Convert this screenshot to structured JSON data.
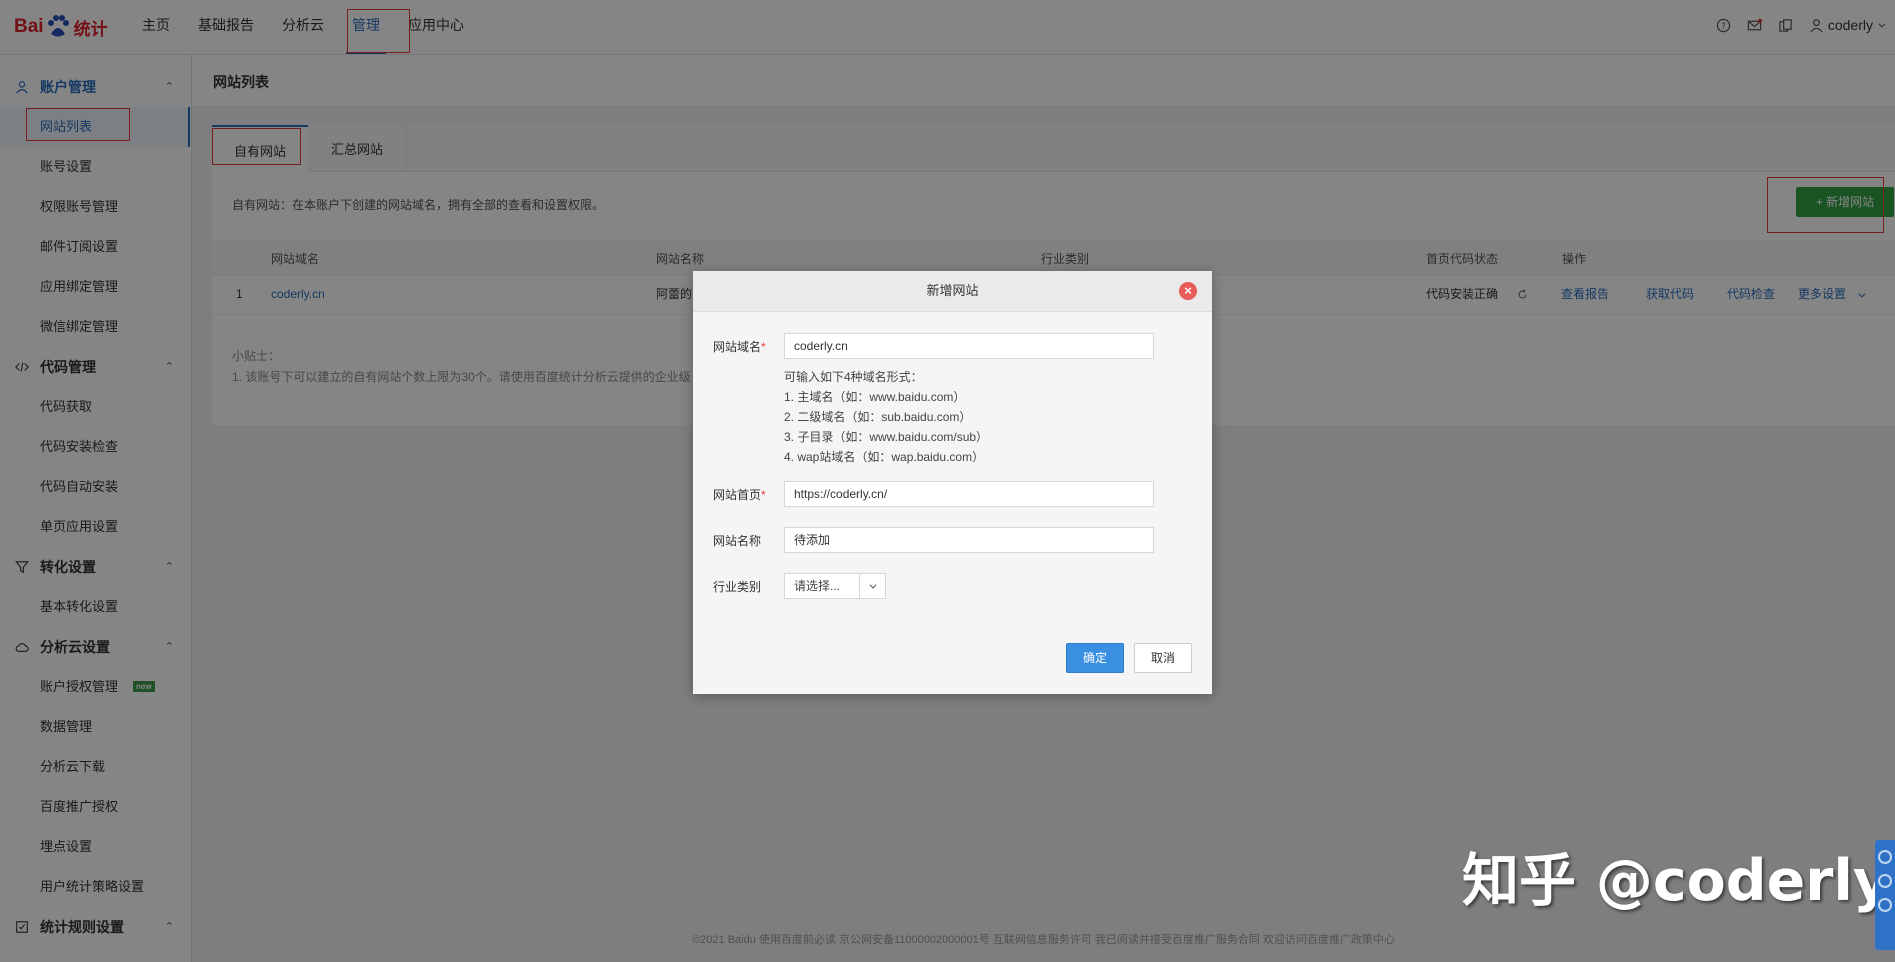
{
  "brand": {
    "logo_bai": "Bai",
    "logo_tongji": "统计"
  },
  "nav": {
    "items": [
      "主页",
      "基础报告",
      "分析云",
      "管理",
      "应用中心"
    ],
    "active_index": 3
  },
  "user": {
    "name": "coderly"
  },
  "sidebar": {
    "groups": [
      {
        "label": "账户管理",
        "icon": "user-icon",
        "items": [
          "网站列表",
          "账号设置",
          "权限账号管理",
          "邮件订阅设置",
          "应用绑定管理",
          "微信绑定管理"
        ]
      },
      {
        "label": "代码管理",
        "icon": "code-icon",
        "items": [
          "代码获取",
          "代码安装检查",
          "代码自动安装",
          "单页应用设置"
        ]
      },
      {
        "label": "转化设置",
        "icon": "funnel-icon",
        "items": [
          "基本转化设置"
        ]
      },
      {
        "label": "分析云设置",
        "icon": "cloud-icon",
        "items": [
          "账户授权管理",
          "数据管理",
          "分析云下载",
          "百度推广授权",
          "埋点设置",
          "用户统计策略设置"
        ]
      },
      {
        "label": "统计规则设置",
        "icon": "rules-icon",
        "items": [
          "..."
        ]
      }
    ],
    "new_badge": "new"
  },
  "page": {
    "title": "网站列表"
  },
  "tabs": [
    "自有网站",
    "汇总网站"
  ],
  "description": "自有网站：在本账户下创建的网站域名，拥有全部的查看和设置权限。",
  "add_button": "+ 新增网站",
  "table": {
    "columns": [
      "网站域名",
      "网站名称",
      "行业类别",
      "首页代码状态",
      "操作"
    ],
    "rows": [
      {
        "index": "1",
        "domain": "coderly.cn",
        "name": "阿蕾的",
        "status": "代码安装正确",
        "actions": [
          "查看报告",
          "获取代码",
          "代码检查",
          "更多设置"
        ]
      }
    ]
  },
  "tips": {
    "title": "小贴士：",
    "line1": "1. 该账号下可以建立的自有网站个数上限为30个。请使用百度统计分析云提供的企业级"
  },
  "footer": "©2021 Baidu 使用百度前必读 京公网安备11000002000001号 互联网信息服务许可 我已阅读并接受百度推广服务合同 欢迎访问百度推广政策中心",
  "watermark": "知乎 @coderly",
  "dialog": {
    "title": "新增网站",
    "domain_label": "网站域名",
    "domain_value": "coderly.cn",
    "hints": [
      "可输入如下4种域名形式：",
      "1. 主域名（如：www.baidu.com）",
      "2. 二级域名（如：sub.baidu.com）",
      "3. 子目录（如：www.baidu.com/sub）",
      "4. wap站域名（如：wap.baidu.com）"
    ],
    "homepage_label": "网站首页",
    "homepage_value": "https://coderly.cn/",
    "name_label": "网站名称",
    "name_value": "待添加",
    "industry_label": "行业类别",
    "industry_value": "请选择...",
    "ok": "确定",
    "cancel": "取消"
  },
  "colors": {
    "accent": "#2a6ebf",
    "add_green": "#33a244",
    "ok_blue": "#3b8fe0",
    "annotation_red": "#e53a3a"
  }
}
